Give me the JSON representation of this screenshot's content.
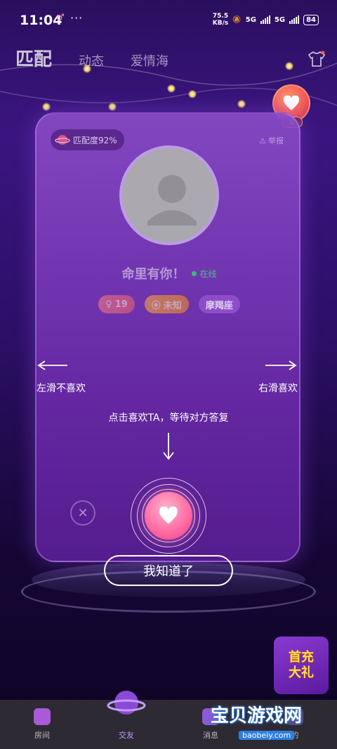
{
  "status_bar": {
    "time": "11:04",
    "dots": "···",
    "net_speed_value": "75.5",
    "net_speed_unit": "KB/s",
    "signal1": "5G",
    "signal2": "5G",
    "battery": "84"
  },
  "top_nav": {
    "tabs": [
      {
        "label": "匹配"
      },
      {
        "label": "动态"
      },
      {
        "label": "爱情海"
      }
    ]
  },
  "heart_counter": {
    "count": "0"
  },
  "card": {
    "match_label": "匹配度92%",
    "report_label": "举报",
    "username": "命里有你！",
    "online_status": "在线",
    "tags": {
      "age": "19",
      "location": "未知",
      "zodiac": "摩羯座"
    }
  },
  "guide": {
    "swipe_left": "左滑不喜欢",
    "swipe_right": "右滑喜欢",
    "tap_hint": "点击喜欢TA，等待对方答复",
    "got_it": "我知道了"
  },
  "promo": {
    "line1": "首充",
    "line2": "大礼"
  },
  "bottom_tabs": [
    {
      "label": "房间"
    },
    {
      "label": "交友"
    },
    {
      "label": "消息"
    },
    {
      "label": "的"
    }
  ],
  "watermark": {
    "title": "宝贝游戏网",
    "url": "baobeiy.com"
  }
}
